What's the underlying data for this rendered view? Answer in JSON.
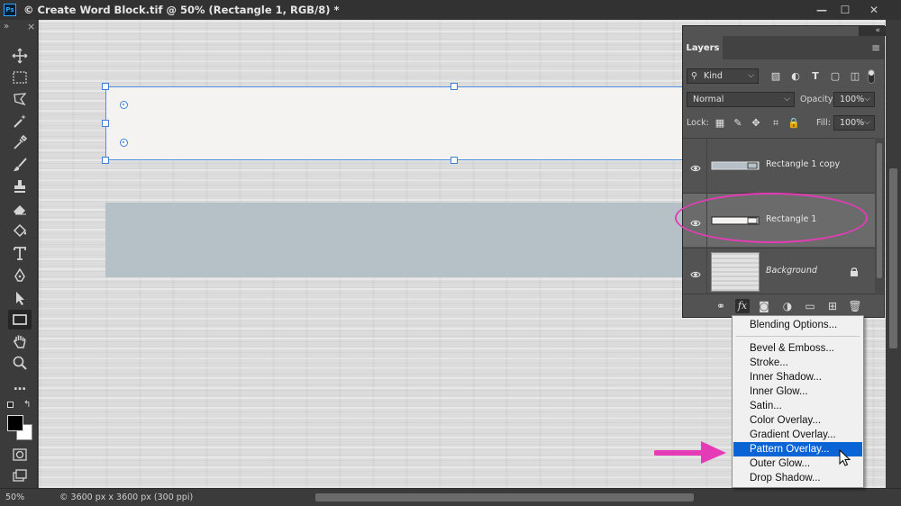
{
  "window": {
    "title": "© Create Word Block.tif @ 50% (Rectangle 1, RGB/8) *",
    "ps_logo": "Ps",
    "minimize": "—",
    "maximize": "☐",
    "close": "✕"
  },
  "toolbar": {
    "collapse": "»",
    "close": "×",
    "active_tool": "rectangle-tool",
    "more": "…"
  },
  "layers_panel": {
    "collapse": "«",
    "tab_label": "Layers",
    "filter_label": "Kind",
    "blend_mode": "Normal",
    "opacity_label": "Opacity:",
    "opacity_value": "100%",
    "lock_label": "Lock:",
    "fill_label": "Fill:",
    "fill_value": "100%",
    "layers": [
      {
        "name": "Rectangle 1 copy",
        "visible": true,
        "selected": false
      },
      {
        "name": "Rectangle 1",
        "visible": true,
        "selected": true
      },
      {
        "name": "Background",
        "visible": true,
        "selected": false,
        "locked": true
      }
    ],
    "footer_fx": "fx"
  },
  "fx_menu": {
    "items": [
      "Blending Options...",
      "Bevel & Emboss...",
      "Stroke...",
      "Inner Shadow...",
      "Inner Glow...",
      "Satin...",
      "Color Overlay...",
      "Gradient Overlay...",
      "Pattern Overlay...",
      "Outer Glow...",
      "Drop Shadow..."
    ],
    "highlighted": "Pattern Overlay..."
  },
  "statusbar": {
    "zoom": "50%",
    "doc_info": "© 3600 px x 3600 px (300 ppi)"
  },
  "colors": {
    "annotation": "#e63bb6",
    "selection": "#4e8fe0",
    "menu_highlight": "#0a64d6",
    "rect_copy_fill": "#b5c1c6",
    "rect_fill": "#f4f3f1"
  }
}
